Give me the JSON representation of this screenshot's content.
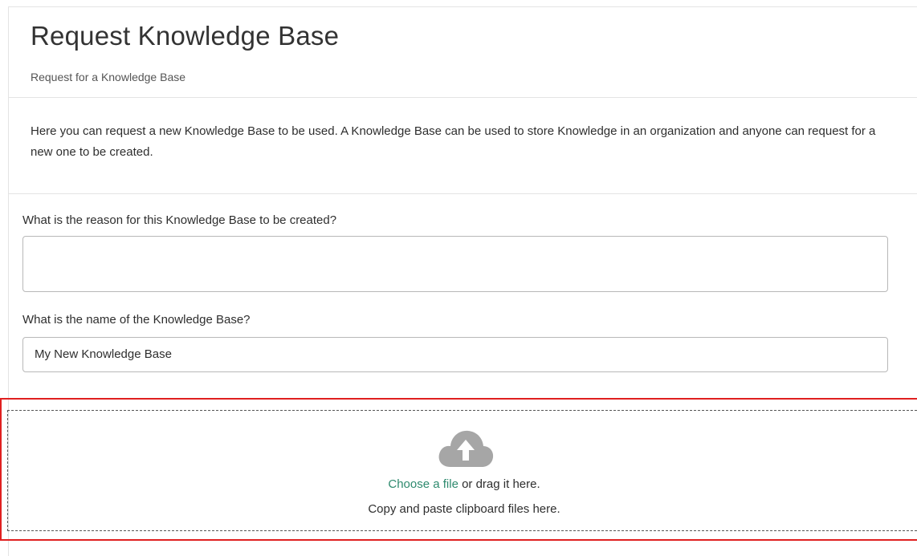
{
  "header": {
    "title": "Request Knowledge Base",
    "subtitle": "Request for a Knowledge Base"
  },
  "intro": {
    "text": "Here you can request a new Knowledge Base to be used. A Knowledge Base can be used to store Knowledge in an organization and anyone can request for a new one to be created."
  },
  "form": {
    "reason_label": "What is the reason for this Knowledge Base to be created?",
    "reason_value": "",
    "name_label": "What is the name of the Knowledge Base?",
    "name_value": "My New Knowledge Base"
  },
  "dropzone": {
    "icon": "cloud-upload-icon",
    "choose_link": "Choose a file",
    "drag_text": " or drag it here.",
    "paste_text": "Copy and paste clipboard files here."
  },
  "colors": {
    "link": "#2e8a6e",
    "highlight": "#e02020",
    "icon": "#a6a6a6"
  }
}
